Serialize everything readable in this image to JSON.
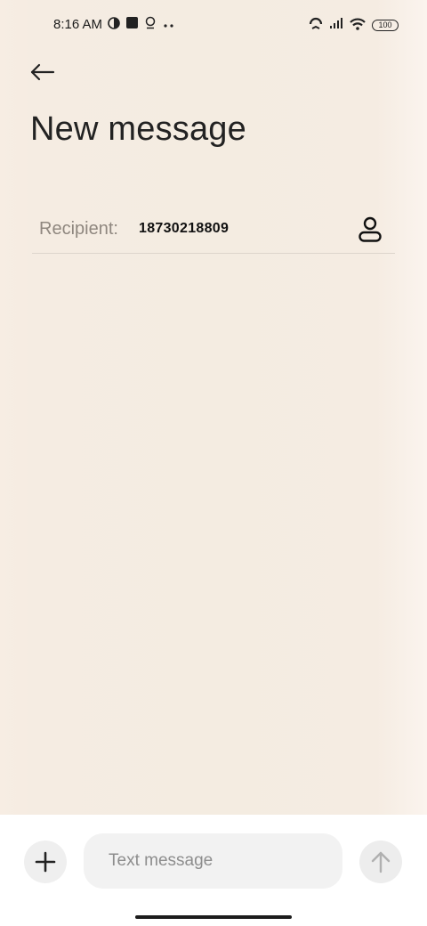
{
  "status_bar": {
    "time": "8:16 AM",
    "battery": "100",
    "icons_left": [
      "vpn-icon",
      "notification-square-icon",
      "location-icon",
      "more-dots-icon"
    ],
    "icons_right": [
      "hotspot-icon",
      "signal-icon",
      "wifi-icon",
      "battery-icon"
    ]
  },
  "header": {
    "back_icon": "back-arrow-icon",
    "title": "New message"
  },
  "recipient": {
    "label": "Recipient:",
    "value": "18730218809",
    "contact_icon": "contact-person-icon"
  },
  "composer": {
    "placeholder": "Text message",
    "add_icon": "plus-icon",
    "send_icon": "send-arrow-icon"
  },
  "colors": {
    "background": "#f4ece1",
    "accent_text": "#8f877f",
    "input_bg": "#f2f2f2"
  }
}
